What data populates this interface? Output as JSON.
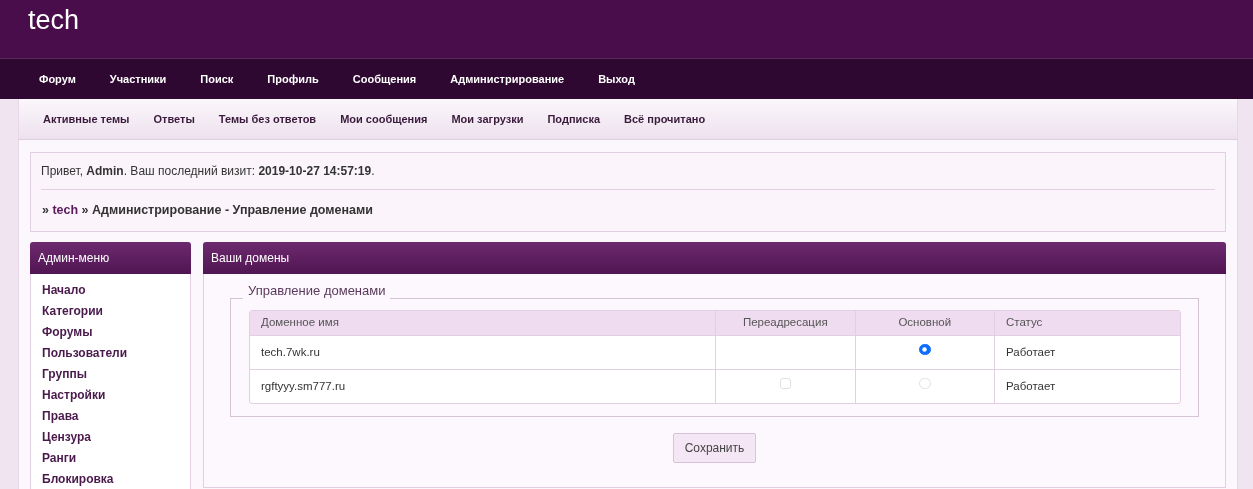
{
  "site": {
    "title": "tech"
  },
  "main_nav": [
    {
      "label": "Форум"
    },
    {
      "label": "Участники"
    },
    {
      "label": "Поиск"
    },
    {
      "label": "Профиль"
    },
    {
      "label": "Сообщения"
    },
    {
      "label": "Администрирование"
    },
    {
      "label": "Выход"
    }
  ],
  "sub_nav": [
    {
      "label": "Активные темы"
    },
    {
      "label": "Ответы"
    },
    {
      "label": "Темы без ответов"
    },
    {
      "label": "Мои сообщения"
    },
    {
      "label": "Мои загрузки"
    },
    {
      "label": "Подписка"
    },
    {
      "label": "Всё прочитано"
    }
  ],
  "greeting": "Привет, **Admin**.  Ваш последний визит: **2019-10-27 14:57:19**.",
  "breadcrumb": {
    "prefix": "»",
    "link": "tech",
    "rest": "» Администрирование - Управление доменами"
  },
  "admin_menu": {
    "title": "Админ-меню",
    "items": [
      {
        "label": "Начало"
      },
      {
        "label": "Категории"
      },
      {
        "label": "Форумы"
      },
      {
        "label": "Пользователи"
      },
      {
        "label": "Группы"
      },
      {
        "label": "Настройки"
      },
      {
        "label": "Права"
      },
      {
        "label": "Цензура"
      },
      {
        "label": "Ранги"
      },
      {
        "label": "Блокировка"
      }
    ]
  },
  "domains_panel": {
    "title": "Ваши домены",
    "fieldset_legend": "Управление доменами",
    "table": {
      "columns": [
        "Доменное имя",
        "Переадресация",
        "Основной",
        "Статус"
      ],
      "rows": [
        {
          "domain": "tech.7wk.ru",
          "primary_selected": true,
          "status": "Работает"
        },
        {
          "domain": "rgftyyy.sm777.ru",
          "redirect": {
            "checked": false
          },
          "primary_selected": false,
          "status": "Работает"
        }
      ]
    },
    "save_button": "Сохранить"
  }
}
